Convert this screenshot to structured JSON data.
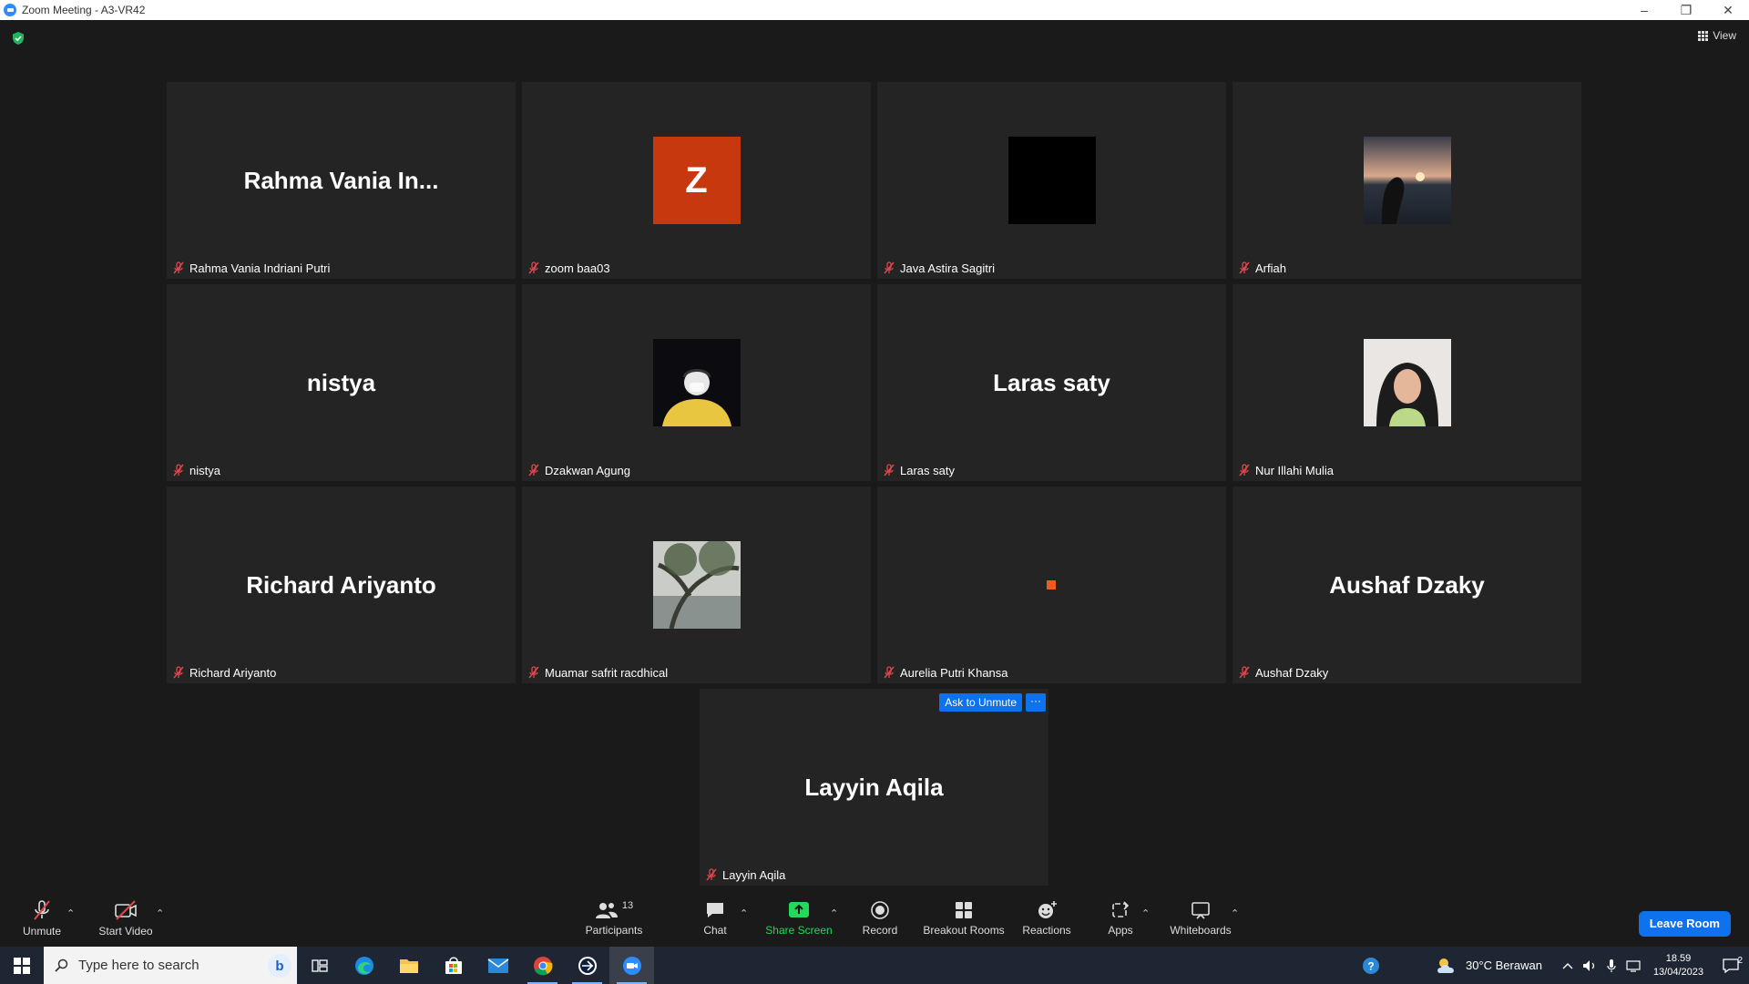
{
  "window": {
    "title": "Zoom Meeting - A3-VR42",
    "controls": [
      "–",
      "❐",
      "✕"
    ]
  },
  "meeting": {
    "view_label": "View",
    "ask_unmute_label": "Ask to Unmute",
    "more_label": "···",
    "tiles": [
      {
        "big": "Rahma Vania In...",
        "name": "Rahma Vania Indriani Putri",
        "kind": "text"
      },
      {
        "big": "Z",
        "name": "zoom baa03",
        "kind": "letter",
        "color": "#c8380f"
      },
      {
        "big": "",
        "name": "Java Astira Sagitri",
        "kind": "black"
      },
      {
        "big": "",
        "name": "Arfiah",
        "kind": "sunset"
      },
      {
        "big": "nistya",
        "name": "nistya",
        "kind": "text"
      },
      {
        "big": "",
        "name": "Dzakwan Agung",
        "kind": "rider"
      },
      {
        "big": "Laras saty",
        "name": "Laras saty",
        "kind": "text"
      },
      {
        "big": "",
        "name": "Nur Illahi Mulia",
        "kind": "portrait"
      },
      {
        "big": "Richard Ariyanto",
        "name": "Richard Ariyanto",
        "kind": "text"
      },
      {
        "big": "",
        "name": "Muamar safrit racdhical",
        "kind": "tree"
      },
      {
        "big": "",
        "name": "Aurelia Putri Khansa",
        "kind": "dot"
      },
      {
        "big": "Aushaf Dzaky",
        "name": "Aushaf Dzaky",
        "kind": "text"
      },
      {
        "big": "Layyin Aqila",
        "name": "Layyin Aqila",
        "kind": "text"
      }
    ]
  },
  "toolbar": {
    "unmute": "Unmute",
    "start_video": "Start Video",
    "participants": "Participants",
    "participants_count": "13",
    "chat": "Chat",
    "share_screen": "Share Screen",
    "record": "Record",
    "breakout_rooms": "Breakout Rooms",
    "reactions": "Reactions",
    "apps": "Apps",
    "whiteboards": "Whiteboards",
    "leave": "Leave Room"
  },
  "taskbar": {
    "search_placeholder": "Type here to search",
    "weather": "30°C  Berawan",
    "time": "18.59",
    "date": "13/04/2023",
    "notifications": "2"
  },
  "colors": {
    "accent": "#0e72ed",
    "share_green": "#23d959",
    "muted_red": "#e0474c"
  }
}
